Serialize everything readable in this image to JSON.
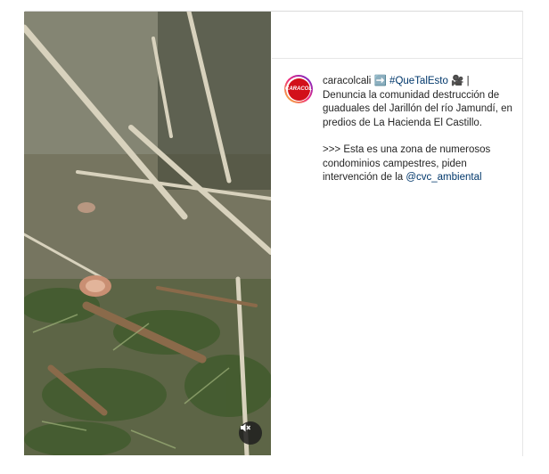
{
  "post": {
    "account": {
      "username": "caracolcali",
      "avatar_text": "CARACOL"
    },
    "caption": {
      "arrow": " ➡️ ",
      "hashtag": "#QueTalEsto",
      "after_hashtag": " 🎥 | Denuncia la comunidad destrucción de guaduales del Jarillón del río Jamundí, en predios de La Hacienda El Castillo.",
      "paragraph2_text": ">>> Esta es una zona de numerosos condominios campestres, piden intervención de la ",
      "mention": "@cvc_ambiental"
    },
    "video": {
      "muted_icon": "speaker-muted-icon"
    }
  },
  "colors": {
    "link": "#00376b",
    "text": "#262626",
    "avatar_brand": "#d2101a"
  }
}
